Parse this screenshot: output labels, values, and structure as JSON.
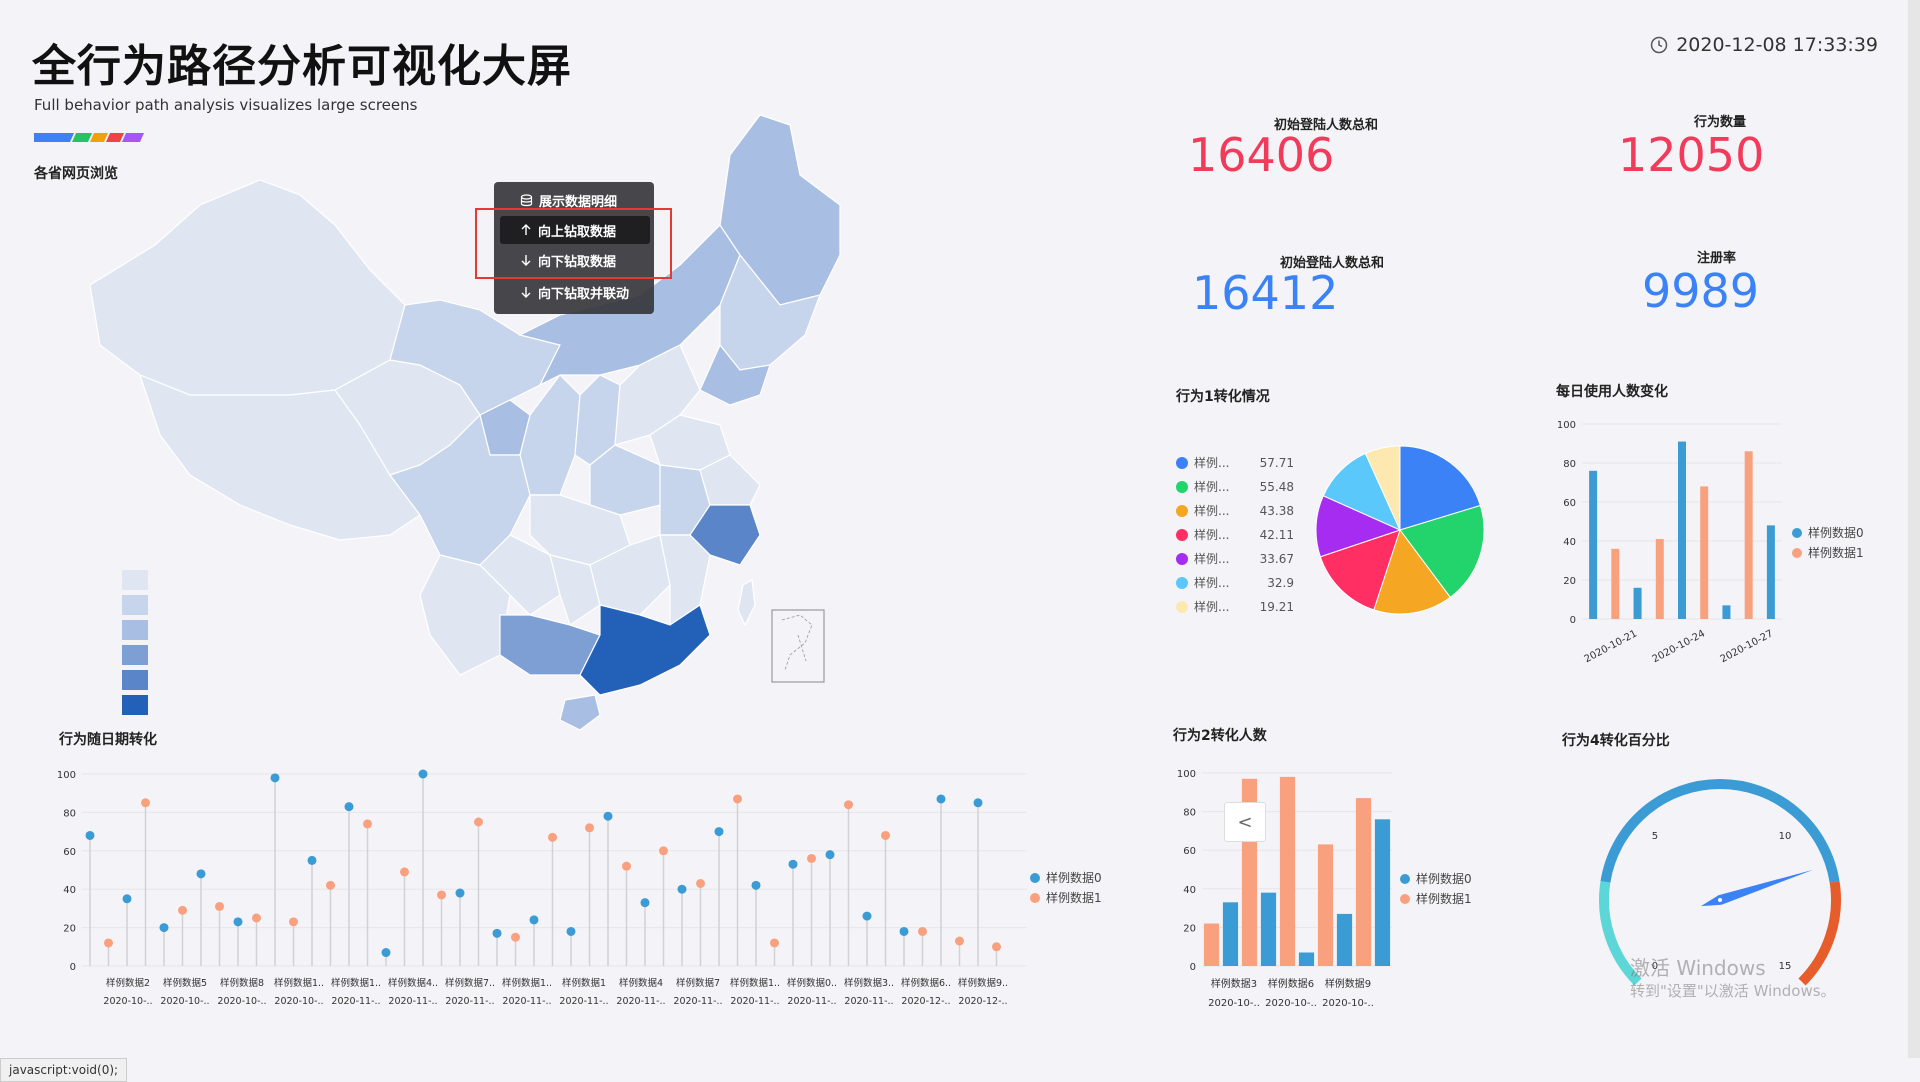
{
  "header": {
    "title": "全行为路径分析可视化大屏",
    "subtitle": "Full behavior path analysis visualizes large screens",
    "datetime": "2020-12-08 17:33:39",
    "stripe_colors": [
      "#3b82f6",
      "#22c55e",
      "#f59e0b",
      "#ef4444",
      "#a855f7"
    ]
  },
  "map": {
    "title": "各省网页浏览",
    "legend_colors": [
      "#dfe6f2",
      "#c6d4ec",
      "#a8bee3",
      "#7e9fd4",
      "#5a85c8",
      "#2360b8"
    ],
    "context_menu": {
      "items": [
        "展示数据明细",
        "向上钻取数据",
        "向下钻取数据",
        "向下钻取并联动"
      ],
      "icons": [
        "database-icon",
        "arrow-up-icon",
        "arrow-down-icon",
        "arrow-down-icon"
      ],
      "highlighted": [
        "向上钻取数据",
        "向下钻取数据"
      ]
    }
  },
  "kpis": [
    {
      "label": "初始登陆人数总和",
      "value": "16406",
      "color": "#f23a5b"
    },
    {
      "label": "行为数量",
      "value": "12050",
      "color": "#f23a5b"
    },
    {
      "label": "初始登陆人数总和",
      "value": "16412",
      "color": "#3b82f6"
    },
    {
      "label": "注册率",
      "value": "9989",
      "color": "#3b82f6"
    }
  ],
  "pie_panel": {
    "title": "行为1转化情况",
    "legend": [
      {
        "label": "样例...",
        "value": "57.71",
        "color": "#3b82f6"
      },
      {
        "label": "样例...",
        "value": "55.48",
        "color": "#22d46b"
      },
      {
        "label": "样例...",
        "value": "43.38",
        "color": "#f5a623"
      },
      {
        "label": "样例...",
        "value": "42.11",
        "color": "#ff2e63"
      },
      {
        "label": "样例...",
        "value": "33.67",
        "color": "#a52cf0"
      },
      {
        "label": "样例...",
        "value": "32.9",
        "color": "#5ac8fa"
      },
      {
        "label": "样例...",
        "value": "19.21",
        "color": "#fde9b0"
      }
    ]
  },
  "daily_panel": {
    "title": "每日使用人数变化"
  },
  "lollipop_panel": {
    "title": "行为随日期转化"
  },
  "bar2_panel": {
    "title": "行为2转化人数",
    "nav_prev": "<"
  },
  "gauge_panel": {
    "title": "行为4转化百分比"
  },
  "legend_series": {
    "s0": "样例数据0",
    "s1": "样例数据1"
  },
  "chart_data": [
    {
      "type": "pie",
      "title": "行为1转化情况",
      "labels": [
        "样例...",
        "样例...",
        "样例...",
        "样例...",
        "样例...",
        "样例...",
        "样例..."
      ],
      "values": [
        57.71,
        55.48,
        43.38,
        42.11,
        33.67,
        32.9,
        19.21
      ],
      "colors": [
        "#3b82f6",
        "#22d46b",
        "#f5a623",
        "#ff2e63",
        "#a52cf0",
        "#5ac8fa",
        "#fde9b0"
      ]
    },
    {
      "type": "bar",
      "title": "每日使用人数变化",
      "ylim": [
        0,
        100
      ],
      "yticks": [
        0,
        20,
        40,
        60,
        80,
        100
      ],
      "xtick_labels": [
        "2020-10-21",
        "2020-10-24",
        "2020-10-27"
      ],
      "series": [
        {
          "name": "样例数据0",
          "color": "#3a9bd5",
          "values": [
            76,
            0,
            16,
            0,
            91,
            0,
            7,
            0,
            48
          ]
        },
        {
          "name": "样例数据1",
          "color": "#f9a07f",
          "values": [
            0,
            36,
            0,
            41,
            0,
            68,
            0,
            86,
            0
          ]
        }
      ]
    },
    {
      "type": "scatter",
      "title": "行为随日期转化",
      "ylim": [
        0,
        100
      ],
      "yticks": [
        0,
        20,
        40,
        60,
        80,
        100
      ],
      "category_labels": [
        "样例数据2",
        "样例数据5",
        "样例数据8",
        "样例数据1..",
        "样例数据1..",
        "样例数据4..",
        "样例数据7..",
        "样例数据1..",
        "样例数据1",
        "样例数据4",
        "样例数据7",
        "样例数据1..",
        "样例数据0..",
        "样例数据3..",
        "样例数据6..",
        "样例数据9.."
      ],
      "date_labels": [
        "2020-10-..",
        "2020-10-..",
        "2020-10-..",
        "2020-10-..",
        "2020-11-..",
        "2020-11-..",
        "2020-11-..",
        "2020-11-..",
        "2020-11-..",
        "2020-11-..",
        "2020-11-..",
        "2020-11-..",
        "2020-11-..",
        "2020-11-..",
        "2020-12-..",
        "2020-12-.."
      ],
      "series": [
        {
          "name": "样例数据0",
          "color": "#3a9bd5",
          "values": [
            68,
            35,
            20,
            48,
            23,
            98,
            55,
            83,
            7,
            100,
            38,
            17,
            24,
            18,
            78,
            33,
            40,
            70,
            42,
            53,
            58,
            26,
            18,
            87,
            85
          ]
        },
        {
          "name": "样例数据1",
          "color": "#f9a07f",
          "values": [
            12,
            85,
            29,
            31,
            25,
            23,
            42,
            74,
            49,
            37,
            75,
            15,
            67,
            72,
            52,
            60,
            43,
            87,
            12,
            56,
            84,
            68,
            18,
            13,
            10
          ]
        }
      ]
    },
    {
      "type": "bar",
      "title": "行为2转化人数",
      "ylim": [
        0,
        100
      ],
      "yticks": [
        0,
        20,
        40,
        60,
        80,
        100
      ],
      "category_labels": [
        "样例数据3",
        "样例数据6",
        "样例数据9"
      ],
      "date_labels": [
        "2020-10-..",
        "2020-10-..",
        "2020-10-.."
      ],
      "series": [
        {
          "name": "样例数据0",
          "color": "#3a9bd5",
          "values": [
            0,
            33,
            0,
            38,
            0,
            7,
            0,
            27,
            0,
            76
          ]
        },
        {
          "name": "样例数据1",
          "color": "#f9a07f",
          "values": [
            22,
            0,
            97,
            0,
            98,
            0,
            63,
            0,
            87,
            0
          ]
        }
      ]
    },
    {
      "type": "gauge",
      "title": "行为4转化百分比",
      "min": 0,
      "max": 15,
      "tick_labels": [
        "0",
        "5",
        "10",
        "15"
      ],
      "value": 11.5,
      "band_colors": [
        "#5cd6d6",
        "#3a9bd5",
        "#e65c2a"
      ]
    }
  ],
  "watermark": {
    "line1": "激活 Windows",
    "line2": "转到\"设置\"以激活 Windows。"
  },
  "status_bar": {
    "url": "javascript:void(0);"
  }
}
